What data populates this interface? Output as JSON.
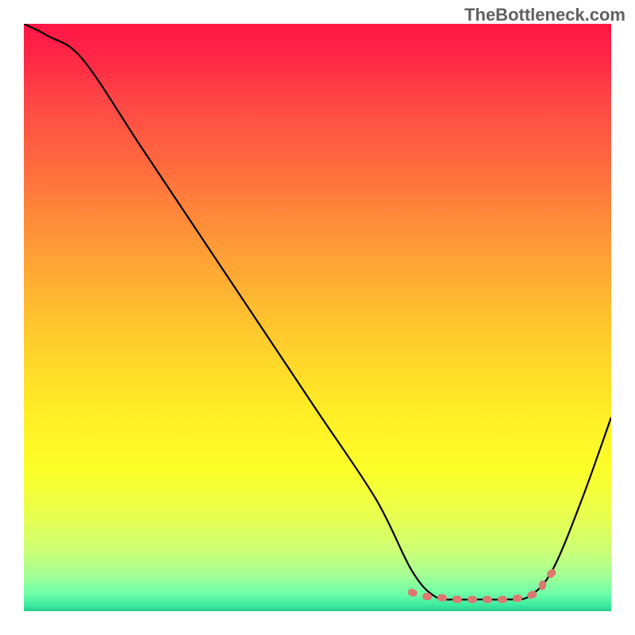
{
  "watermark": "TheBottleneck.com",
  "chart_data": {
    "type": "line",
    "title": "",
    "xlabel": "",
    "ylabel": "",
    "xlim": [
      0,
      100
    ],
    "ylim": [
      0,
      100
    ],
    "grid": false,
    "series": [
      {
        "name": "bottleneck-curve",
        "x": [
          0,
          4,
          10,
          20,
          30,
          40,
          50,
          60,
          66,
          70,
          74,
          78,
          82,
          86,
          90,
          95,
          100
        ],
        "y": [
          100,
          98,
          94,
          79,
          64,
          49,
          34,
          19,
          7,
          2.5,
          2,
          2,
          2,
          2.5,
          7,
          19,
          33
        ],
        "stroke": "#000000"
      }
    ],
    "annotations": [
      {
        "name": "valley-band",
        "x": [
          66,
          68,
          70,
          72,
          74,
          76,
          78,
          80,
          82,
          84,
          86,
          88,
          88.5,
          90
        ],
        "y": [
          3.2,
          2.6,
          2.4,
          2.2,
          2.0,
          2.0,
          2.0,
          2.0,
          2.0,
          2.2,
          2.6,
          3.6,
          5.0,
          6.6
        ],
        "stroke": "#de7770",
        "style": "dashed"
      }
    ]
  }
}
